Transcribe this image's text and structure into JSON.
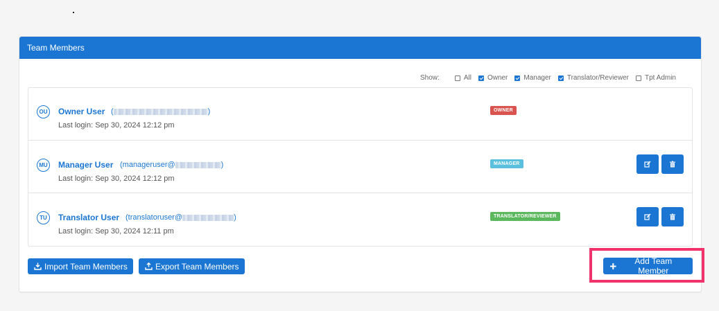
{
  "panel": {
    "title": "Team Members"
  },
  "filters": {
    "show_label": "Show:",
    "options": [
      {
        "label": "All",
        "checked": false
      },
      {
        "label": "Owner",
        "checked": true
      },
      {
        "label": "Manager",
        "checked": true
      },
      {
        "label": "Translator/Reviewer",
        "checked": true
      },
      {
        "label": "Tpt Admin",
        "checked": false
      }
    ]
  },
  "members": [
    {
      "initials": "OU",
      "name": "Owner User",
      "email_open": "(",
      "email_close": ")",
      "last_login": "Last login: Sep 30, 2024 12:12 pm",
      "role": "OWNER",
      "role_color": "#d9534f"
    },
    {
      "initials": "MU",
      "name": "Manager User",
      "email_open": "(manageruser@",
      "email_close": ")",
      "last_login": "Last login: Sep 30, 2024 12:12 pm",
      "role": "MANAGER",
      "role_color": "#5bc0de"
    },
    {
      "initials": "TU",
      "name": "Translator User",
      "email_open": "(translatoruser@",
      "email_close": ")",
      "last_login": "Last login: Sep 30, 2024 12:11 pm",
      "role": "TRANSLATOR/REVIEWER",
      "role_color": "#5cb85c"
    }
  ],
  "actions": {
    "import_label": "Import Team Members",
    "export_label": "Export Team Members",
    "add_label": "Add Team Member"
  },
  "colors": {
    "primary": "#1a76d2",
    "highlight": "#f0336a"
  }
}
